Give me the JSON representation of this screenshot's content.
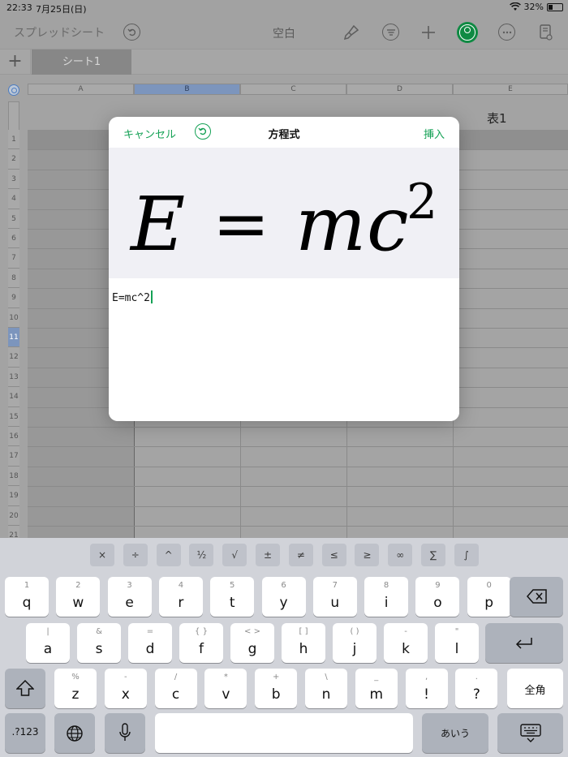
{
  "status": {
    "time": "22:33",
    "date": "7月25日(日)",
    "battery": "32%",
    "battery_level": 0.32
  },
  "toolbar": {
    "back_label": "スプレッドシート",
    "title": "空白",
    "icons": [
      "undo-icon",
      "paintbrush-icon",
      "format-icon",
      "add-icon",
      "collaborate-icon",
      "more-icon",
      "reader-view-icon"
    ]
  },
  "sheet_tabs": {
    "add_label": "+",
    "active_tab": "シート1"
  },
  "grid": {
    "columns": [
      "A",
      "B",
      "C",
      "D",
      "E"
    ],
    "selected_column": "B",
    "rows": [
      "1",
      "2",
      "3",
      "4",
      "5",
      "6",
      "7",
      "8",
      "9",
      "10",
      "11",
      "12",
      "13",
      "14",
      "15",
      "16",
      "17",
      "18",
      "19",
      "20",
      "21"
    ],
    "selected_row": "11",
    "table_title": "表1"
  },
  "equation_dialog": {
    "cancel_label": "キャンセル",
    "title": "方程式",
    "insert_label": "挿入",
    "preview": {
      "lhs": "E",
      "equals": "=",
      "rhs_m": "m",
      "rhs_c": "c",
      "exponent": "2"
    },
    "input_value": "E=mc^2"
  },
  "keyboard": {
    "math_keys": [
      "×",
      "÷",
      "^",
      "½",
      "√",
      "±",
      "≠",
      "≤",
      "≥",
      "∞",
      "∑",
      "∫"
    ],
    "row1": [
      {
        "main": "q",
        "sub": "1"
      },
      {
        "main": "w",
        "sub": "2"
      },
      {
        "main": "e",
        "sub": "3"
      },
      {
        "main": "r",
        "sub": "4"
      },
      {
        "main": "t",
        "sub": "5"
      },
      {
        "main": "y",
        "sub": "6"
      },
      {
        "main": "u",
        "sub": "7"
      },
      {
        "main": "i",
        "sub": "8"
      },
      {
        "main": "o",
        "sub": "9"
      },
      {
        "main": "p",
        "sub": "0"
      }
    ],
    "row2": [
      {
        "main": "a",
        "sub": "|"
      },
      {
        "main": "s",
        "sub": "&"
      },
      {
        "main": "d",
        "sub": "="
      },
      {
        "main": "f",
        "sub": "{  }"
      },
      {
        "main": "g",
        "sub": "<  >"
      },
      {
        "main": "h",
        "sub": "[  ]"
      },
      {
        "main": "j",
        "sub": "(  )"
      },
      {
        "main": "k",
        "sub": "-"
      },
      {
        "main": "l",
        "sub": "\""
      }
    ],
    "row3": [
      {
        "main": "z",
        "sub": "%"
      },
      {
        "main": "x",
        "sub": "-"
      },
      {
        "main": "c",
        "sub": "/"
      },
      {
        "main": "v",
        "sub": "*"
      },
      {
        "main": "b",
        "sub": "+"
      },
      {
        "main": "n",
        "sub": "\\"
      },
      {
        "main": "m",
        "sub": "_"
      },
      {
        "main": "!",
        "sub": ","
      },
      {
        "main": "?",
        "sub": "."
      }
    ],
    "fullwidth_label": "全角",
    "numbers_label": ".?123",
    "kana_label": "あいう"
  }
}
